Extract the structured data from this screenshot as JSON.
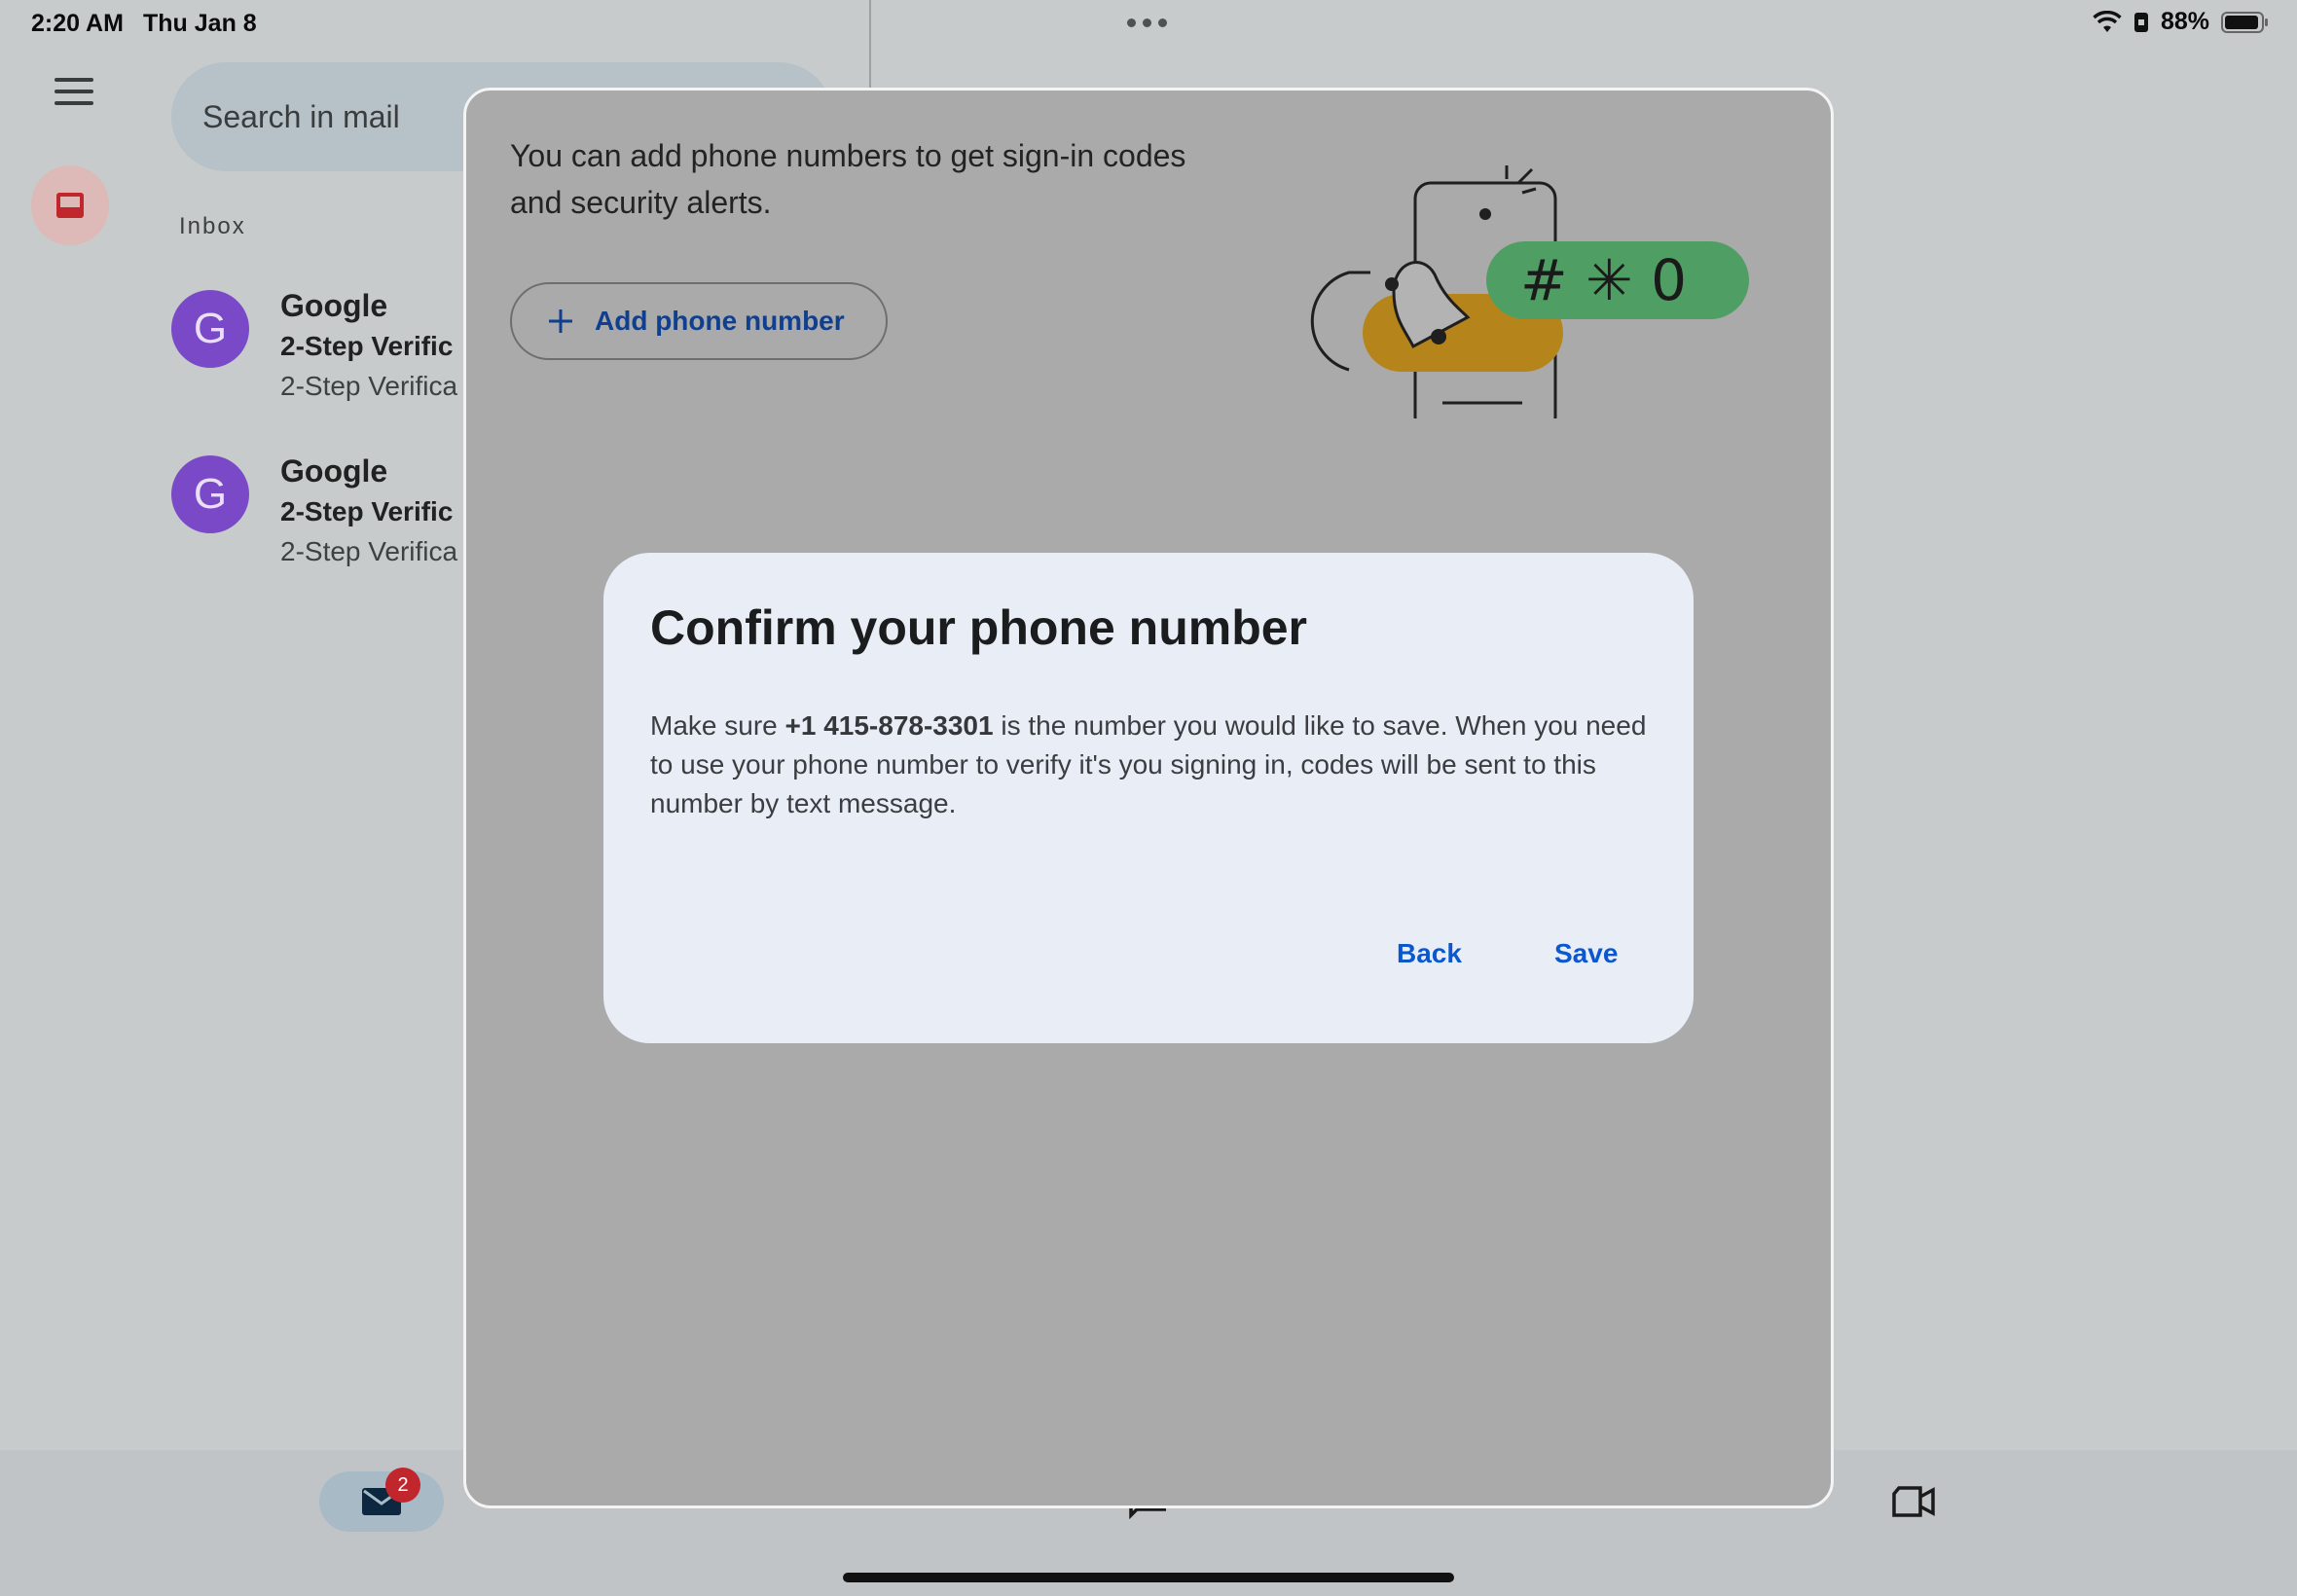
{
  "status_bar": {
    "time": "2:20 AM",
    "date": "Thu Jan 8",
    "battery": "88%",
    "icons": [
      "wifi-icon",
      "lock-rotation-icon",
      "battery-icon"
    ]
  },
  "app": {
    "search_placeholder": "Search in mail",
    "inbox_label": "Inbox",
    "emails": [
      {
        "avatar": "G",
        "sender": "Google",
        "subject": "2-Step Verific",
        "snippet": "2-Step Verifica"
      },
      {
        "avatar": "G",
        "sender": "Google",
        "subject": "2-Step Verific",
        "snippet": "2-Step Verifica"
      }
    ],
    "bottom_nav": {
      "mail_badge": "2",
      "items": [
        "mail-icon",
        "chat-icon",
        "video-icon"
      ]
    }
  },
  "sheet": {
    "description": "You can add phone numbers to get sign-in codes and security alerts.",
    "add_phone_label": "Add phone number",
    "illustration_text": "# ✳ 0"
  },
  "dialog": {
    "title": "Confirm your phone number",
    "body_prefix": "Make sure ",
    "phone_number": "+1 415-878-3301",
    "body_suffix": " is the number you would like to save. When you need to use your phone number to verify it's you signing in, codes will be sent to this number by text message.",
    "back_label": "Back",
    "save_label": "Save"
  },
  "colors": {
    "accent": "#0b57d0",
    "avatar": "#7a49c7",
    "badge": "#c0262c",
    "illustration_green": "#4f9e64",
    "illustration_yellow": "#b5851c"
  }
}
